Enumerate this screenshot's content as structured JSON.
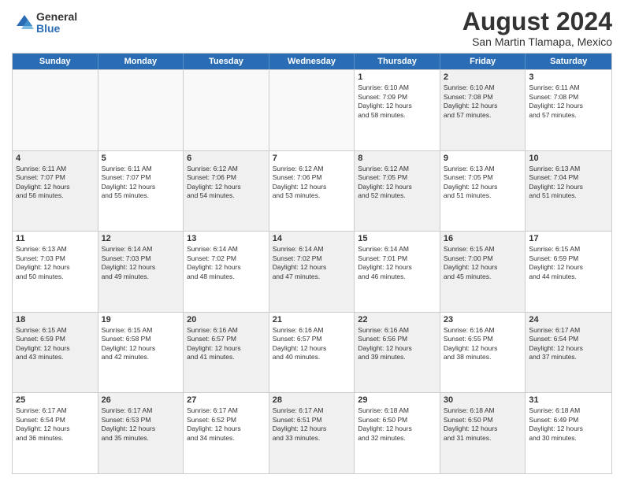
{
  "logo": {
    "general": "General",
    "blue": "Blue"
  },
  "title": "August 2024",
  "subtitle": "San Martin Tlamapa, Mexico",
  "days": [
    "Sunday",
    "Monday",
    "Tuesday",
    "Wednesday",
    "Thursday",
    "Friday",
    "Saturday"
  ],
  "weeks": [
    [
      {
        "day": "",
        "info": "",
        "empty": true
      },
      {
        "day": "",
        "info": "",
        "empty": true
      },
      {
        "day": "",
        "info": "",
        "empty": true
      },
      {
        "day": "",
        "info": "",
        "empty": true
      },
      {
        "day": "1",
        "info": "Sunrise: 6:10 AM\nSunset: 7:09 PM\nDaylight: 12 hours\nand 58 minutes."
      },
      {
        "day": "2",
        "info": "Sunrise: 6:10 AM\nSunset: 7:08 PM\nDaylight: 12 hours\nand 57 minutes.",
        "shaded": true
      },
      {
        "day": "3",
        "info": "Sunrise: 6:11 AM\nSunset: 7:08 PM\nDaylight: 12 hours\nand 57 minutes."
      }
    ],
    [
      {
        "day": "4",
        "info": "Sunrise: 6:11 AM\nSunset: 7:07 PM\nDaylight: 12 hours\nand 56 minutes.",
        "shaded": true
      },
      {
        "day": "5",
        "info": "Sunrise: 6:11 AM\nSunset: 7:07 PM\nDaylight: 12 hours\nand 55 minutes."
      },
      {
        "day": "6",
        "info": "Sunrise: 6:12 AM\nSunset: 7:06 PM\nDaylight: 12 hours\nand 54 minutes.",
        "shaded": true
      },
      {
        "day": "7",
        "info": "Sunrise: 6:12 AM\nSunset: 7:06 PM\nDaylight: 12 hours\nand 53 minutes."
      },
      {
        "day": "8",
        "info": "Sunrise: 6:12 AM\nSunset: 7:05 PM\nDaylight: 12 hours\nand 52 minutes.",
        "shaded": true
      },
      {
        "day": "9",
        "info": "Sunrise: 6:13 AM\nSunset: 7:05 PM\nDaylight: 12 hours\nand 51 minutes."
      },
      {
        "day": "10",
        "info": "Sunrise: 6:13 AM\nSunset: 7:04 PM\nDaylight: 12 hours\nand 51 minutes.",
        "shaded": true
      }
    ],
    [
      {
        "day": "11",
        "info": "Sunrise: 6:13 AM\nSunset: 7:03 PM\nDaylight: 12 hours\nand 50 minutes."
      },
      {
        "day": "12",
        "info": "Sunrise: 6:14 AM\nSunset: 7:03 PM\nDaylight: 12 hours\nand 49 minutes.",
        "shaded": true
      },
      {
        "day": "13",
        "info": "Sunrise: 6:14 AM\nSunset: 7:02 PM\nDaylight: 12 hours\nand 48 minutes."
      },
      {
        "day": "14",
        "info": "Sunrise: 6:14 AM\nSunset: 7:02 PM\nDaylight: 12 hours\nand 47 minutes.",
        "shaded": true
      },
      {
        "day": "15",
        "info": "Sunrise: 6:14 AM\nSunset: 7:01 PM\nDaylight: 12 hours\nand 46 minutes."
      },
      {
        "day": "16",
        "info": "Sunrise: 6:15 AM\nSunset: 7:00 PM\nDaylight: 12 hours\nand 45 minutes.",
        "shaded": true
      },
      {
        "day": "17",
        "info": "Sunrise: 6:15 AM\nSunset: 6:59 PM\nDaylight: 12 hours\nand 44 minutes."
      }
    ],
    [
      {
        "day": "18",
        "info": "Sunrise: 6:15 AM\nSunset: 6:59 PM\nDaylight: 12 hours\nand 43 minutes.",
        "shaded": true
      },
      {
        "day": "19",
        "info": "Sunrise: 6:15 AM\nSunset: 6:58 PM\nDaylight: 12 hours\nand 42 minutes."
      },
      {
        "day": "20",
        "info": "Sunrise: 6:16 AM\nSunset: 6:57 PM\nDaylight: 12 hours\nand 41 minutes.",
        "shaded": true
      },
      {
        "day": "21",
        "info": "Sunrise: 6:16 AM\nSunset: 6:57 PM\nDaylight: 12 hours\nand 40 minutes."
      },
      {
        "day": "22",
        "info": "Sunrise: 6:16 AM\nSunset: 6:56 PM\nDaylight: 12 hours\nand 39 minutes.",
        "shaded": true
      },
      {
        "day": "23",
        "info": "Sunrise: 6:16 AM\nSunset: 6:55 PM\nDaylight: 12 hours\nand 38 minutes."
      },
      {
        "day": "24",
        "info": "Sunrise: 6:17 AM\nSunset: 6:54 PM\nDaylight: 12 hours\nand 37 minutes.",
        "shaded": true
      }
    ],
    [
      {
        "day": "25",
        "info": "Sunrise: 6:17 AM\nSunset: 6:54 PM\nDaylight: 12 hours\nand 36 minutes."
      },
      {
        "day": "26",
        "info": "Sunrise: 6:17 AM\nSunset: 6:53 PM\nDaylight: 12 hours\nand 35 minutes.",
        "shaded": true
      },
      {
        "day": "27",
        "info": "Sunrise: 6:17 AM\nSunset: 6:52 PM\nDaylight: 12 hours\nand 34 minutes."
      },
      {
        "day": "28",
        "info": "Sunrise: 6:17 AM\nSunset: 6:51 PM\nDaylight: 12 hours\nand 33 minutes.",
        "shaded": true
      },
      {
        "day": "29",
        "info": "Sunrise: 6:18 AM\nSunset: 6:50 PM\nDaylight: 12 hours\nand 32 minutes."
      },
      {
        "day": "30",
        "info": "Sunrise: 6:18 AM\nSunset: 6:50 PM\nDaylight: 12 hours\nand 31 minutes.",
        "shaded": true
      },
      {
        "day": "31",
        "info": "Sunrise: 6:18 AM\nSunset: 6:49 PM\nDaylight: 12 hours\nand 30 minutes."
      }
    ]
  ]
}
